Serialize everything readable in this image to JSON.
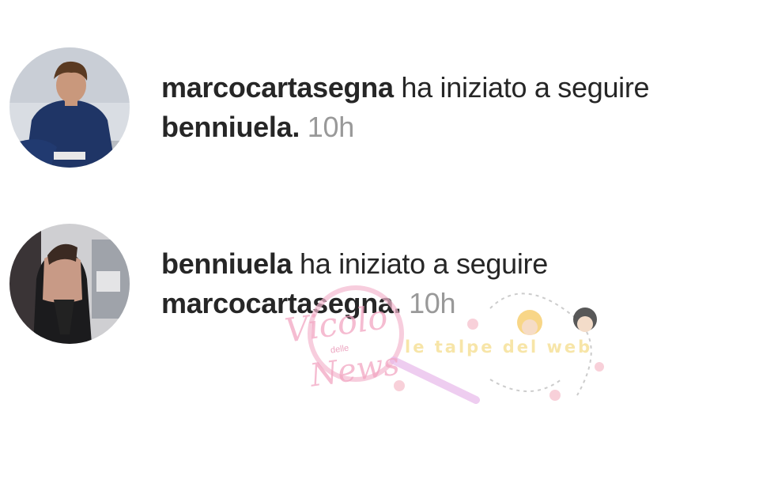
{
  "notifications": [
    {
      "actor": "marcocartasegna",
      "action": "ha iniziato a seguire",
      "target": "benniuela",
      "time": "10h",
      "avatar_icon": "profile-photo-man-blue-shirt"
    },
    {
      "actor": "benniuela",
      "action": "ha iniziato a seguire",
      "target": "marcocartasegna",
      "time": "10h",
      "avatar_icon": "profile-photo-woman-black-dress"
    }
  ],
  "watermark": {
    "brand_top": "Vicolo",
    "brand_small": "delle",
    "brand_bottom": "News",
    "tagline": "le talpe del web"
  },
  "colors": {
    "username": "#262626",
    "timestamp": "#999999",
    "background": "#ffffff",
    "watermark_pink": "#f2a6c2",
    "watermark_yellow": "#f6e19a"
  }
}
